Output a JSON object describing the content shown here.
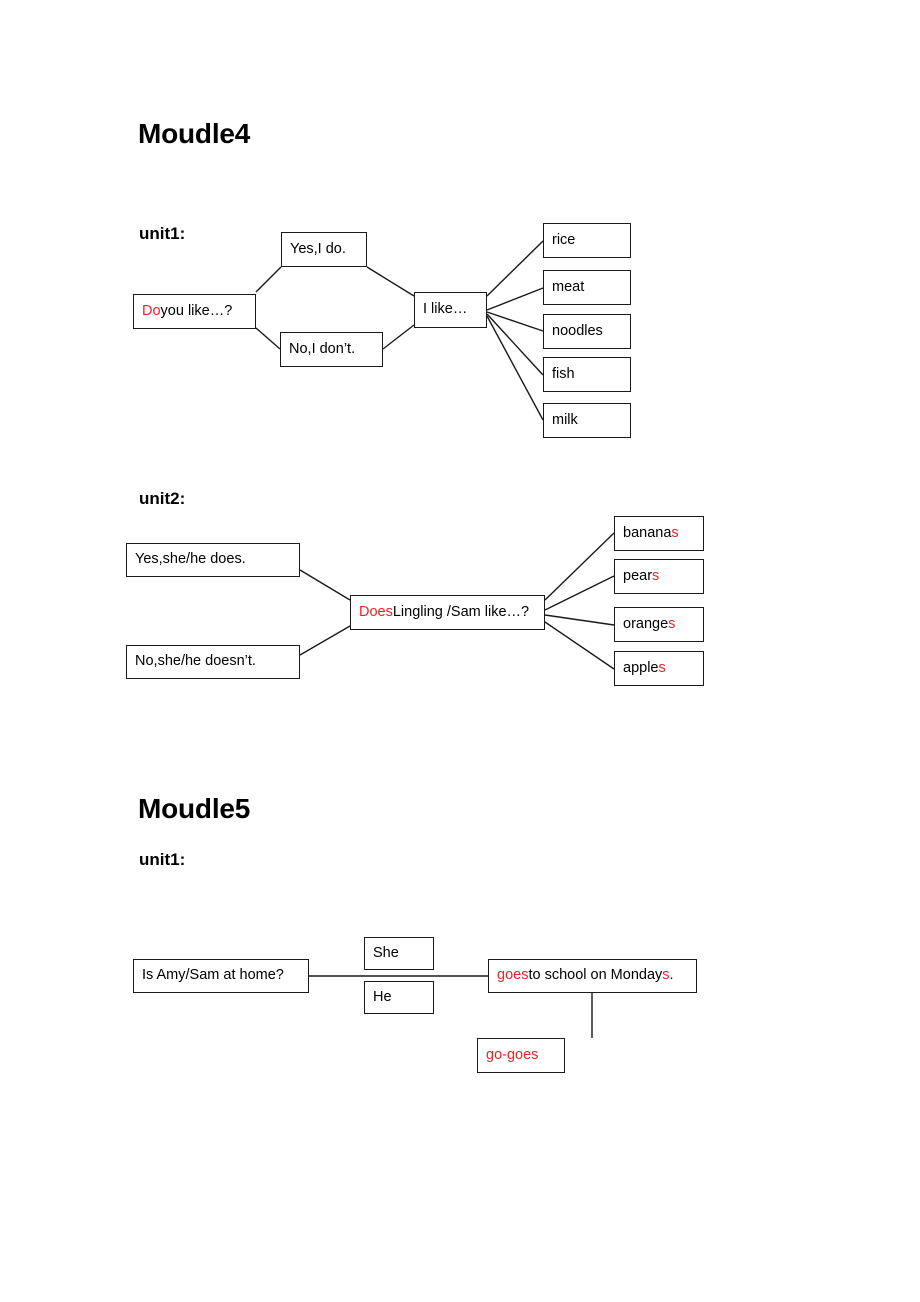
{
  "document": {
    "page_background": "#ffffff",
    "accent_red": "#ec2227",
    "line_color": "#1a1a1a"
  },
  "modules": [
    {
      "title": "Moudle4",
      "units": [
        {
          "label": "unit1:",
          "nodes": {
            "question": {
              "red_part": "Do",
              "black_part": " you like…?"
            },
            "answer_yes": "Yes,I do.",
            "answer_no": "No,I don’t.",
            "statement": "I like…",
            "items": [
              "rice",
              "meat",
              "noodles",
              "fish",
              "milk"
            ]
          }
        },
        {
          "label": "unit2:",
          "nodes": {
            "question": {
              "red_part": "Does",
              "black_part": " Lingling /Sam like…?"
            },
            "answer_yes": "Yes,she/he does.",
            "answer_no": "No,she/he doesn’t.",
            "items": [
              {
                "stem": "banana",
                "red_suffix": "s"
              },
              {
                "stem": "pear",
                "red_suffix": "s"
              },
              {
                "stem": "orange",
                "red_suffix": "s"
              },
              {
                "stem": "apple",
                "red_suffix": "s"
              }
            ]
          }
        }
      ]
    },
    {
      "title": "Moudle5",
      "units": [
        {
          "label": "unit1:",
          "nodes": {
            "question": "Is Amy/Sam at home?",
            "subject_she": "She",
            "subject_he": "He",
            "predicate": {
              "red_part": "goes",
              "black_part": " to school on Monday",
              "red_suffix": "s",
              "tail": "."
            },
            "note": "go-goes"
          }
        }
      ]
    }
  ]
}
